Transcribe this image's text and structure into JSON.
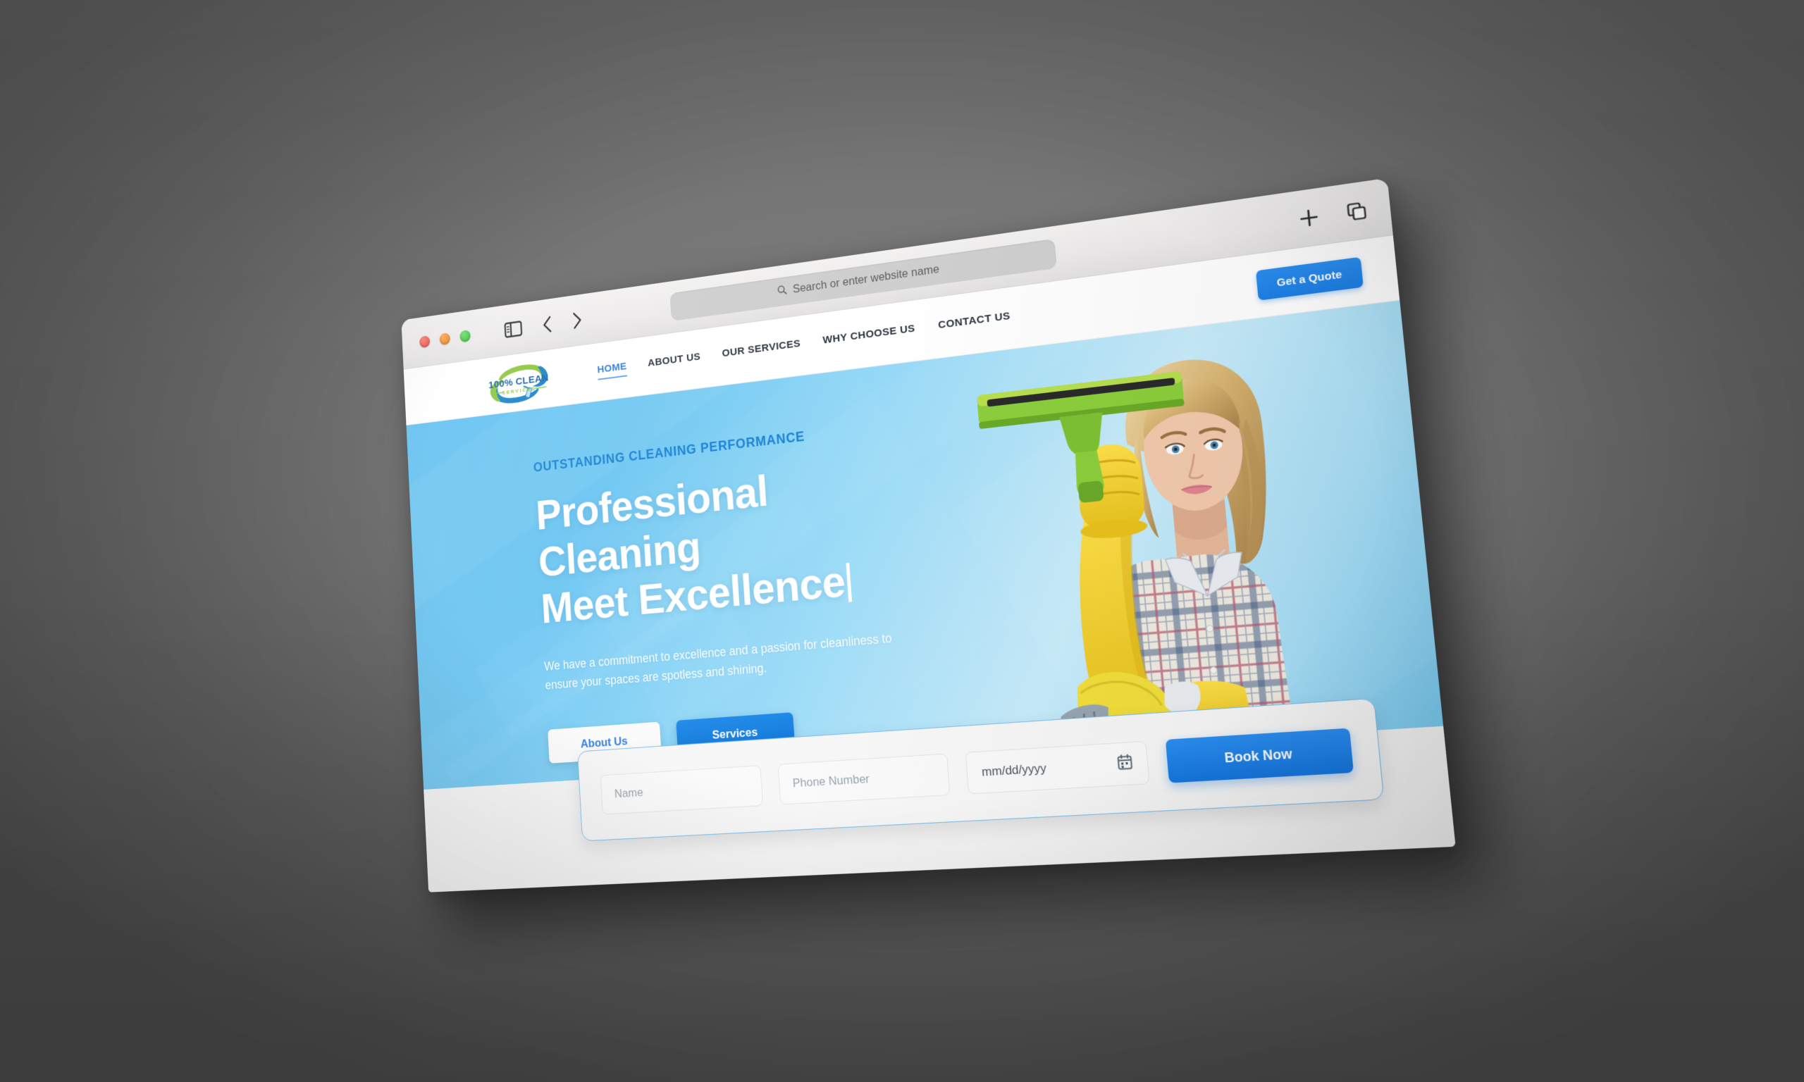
{
  "browser": {
    "traffic_lights": [
      "close",
      "minimize",
      "maximize"
    ],
    "sidebar_icon": "sidebar-icon",
    "back_icon": "chevron-left-icon",
    "forward_icon": "chevron-right-icon",
    "address_bar": {
      "placeholder": "Search or enter website name",
      "value": "",
      "search_icon": "search-icon"
    },
    "new_tab_icon": "plus-icon",
    "tab_overview_icon": "copy-tabs-icon"
  },
  "site": {
    "logo": {
      "line1": "100% CLEAN",
      "line2": "SERVICES",
      "colors": {
        "green": "#8cc63f",
        "blue": "#1b84c7"
      }
    },
    "nav": [
      {
        "label": "HOME",
        "active": true
      },
      {
        "label": "ABOUT US",
        "active": false
      },
      {
        "label": "OUR SERVICES",
        "active": false
      },
      {
        "label": "WHY CHOOSE US",
        "active": false
      },
      {
        "label": "CONTACT US",
        "active": false
      }
    ],
    "quote_button": "Get a Quote"
  },
  "hero": {
    "eyebrow": "OUTSTANDING CLEANING PERFORMANCE",
    "headline_line1": "Professional Cleaning",
    "headline_line2": "Meet Excellence",
    "has_text_caret": true,
    "subtext": "We have a commitment to excellence and a passion for cleanliness to ensure your spaces are spotless and shining.",
    "buttons": [
      {
        "label": "About Us",
        "style": "light"
      },
      {
        "label": "Services",
        "style": "blue"
      }
    ],
    "image_alt": "woman-with-squeegee-photo"
  },
  "booking_form": {
    "name_placeholder": "Name",
    "name_value": "",
    "phone_placeholder": "Phone Number",
    "phone_value": "",
    "date_placeholder": "mm/dd/yyyy",
    "date_value": "",
    "calendar_icon": "calendar-icon",
    "submit_label": "Book Now"
  },
  "colors": {
    "accent_blue": "#1d7fe6",
    "hero_blue_dark": "#5fc0f0",
    "hero_blue_light": "#c8ecfb",
    "nav_text": "#2b3440",
    "background_gray": "#6e6e6e"
  }
}
